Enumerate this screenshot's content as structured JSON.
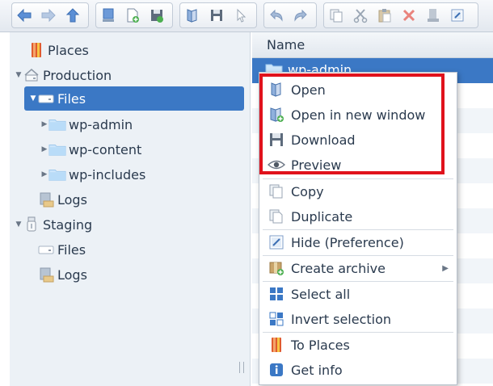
{
  "toolbar": {
    "groups": [
      [
        "back-icon",
        "forward-icon",
        "up-icon"
      ],
      [
        "network-drive-icon",
        "new-file-icon",
        "save-icon"
      ],
      [
        "open-book-icon",
        "floppy-icon",
        "pointer-icon"
      ],
      [
        "undo-icon",
        "redo-icon"
      ],
      [
        "copy-icon",
        "cut-icon",
        "paste-icon",
        "delete-icon",
        "rename-icon",
        "preview-window-icon"
      ]
    ]
  },
  "tree": {
    "places": "Places",
    "production": "Production",
    "files_active": "Files",
    "wp_admin": "wp-admin",
    "wp_content": "wp-content",
    "wp_includes": "wp-includes",
    "logs_prod": "Logs",
    "staging": "Staging",
    "files_staging": "Files",
    "logs_staging": "Logs"
  },
  "list": {
    "column_name": "Name",
    "selected_item": "wp-admin"
  },
  "context_menu": {
    "open": "Open",
    "open_new_window": "Open in new window",
    "download": "Download",
    "preview": "Preview",
    "copy": "Copy",
    "duplicate": "Duplicate",
    "hide": "Hide (Preference)",
    "create_archive": "Create archive",
    "select_all": "Select all",
    "invert_selection": "Invert selection",
    "to_places": "To Places",
    "get_info": "Get info"
  },
  "colors": {
    "selection": "#3b78c5",
    "highlight_frame": "#e0121c",
    "nav_background": "#ecf1f6"
  }
}
